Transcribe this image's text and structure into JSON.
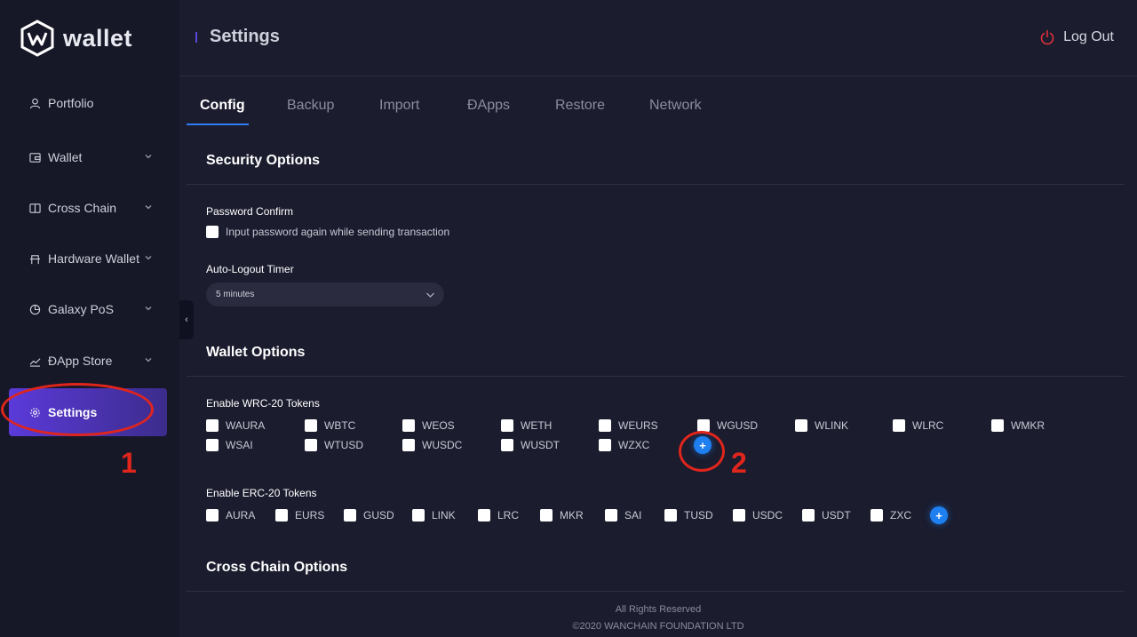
{
  "app": {
    "logo_text": "wallet"
  },
  "sidebar": {
    "items": [
      {
        "label": "Portfolio",
        "icon": "user-icon",
        "has_chevron": false
      },
      {
        "label": "Wallet",
        "icon": "wallet-icon",
        "has_chevron": true
      },
      {
        "label": "Cross Chain",
        "icon": "cross-chain-icon",
        "has_chevron": true
      },
      {
        "label": "Hardware Wallet",
        "icon": "hardware-icon",
        "has_chevron": true
      },
      {
        "label": "Galaxy PoS",
        "icon": "pie-chart-icon",
        "has_chevron": true
      },
      {
        "label": "ĐApp Store",
        "icon": "line-chart-icon",
        "has_chevron": true
      },
      {
        "label": "Settings",
        "icon": "gear-icon",
        "has_chevron": false,
        "active": true
      }
    ]
  },
  "header": {
    "title": "Settings",
    "logout_label": "Log Out"
  },
  "tabs": [
    {
      "label": "Config",
      "active": true
    },
    {
      "label": "Backup"
    },
    {
      "label": "Import"
    },
    {
      "label": "ĐApps"
    },
    {
      "label": "Restore"
    },
    {
      "label": "Network"
    }
  ],
  "security": {
    "title": "Security Options",
    "password_confirm_label": "Password Confirm",
    "password_confirm_checkbox": "Input password again while sending transaction",
    "password_confirm_checked": false,
    "auto_logout_label": "Auto-Logout Timer",
    "auto_logout_value": "5 minutes"
  },
  "wallet_options": {
    "title": "Wallet Options",
    "wrc20_label": "Enable WRC-20 Tokens",
    "wrc20_tokens": [
      "WAURA",
      "WBTC",
      "WEOS",
      "WETH",
      "WEURS",
      "WGUSD",
      "WLINK",
      "WLRC",
      "WMKR",
      "WSAI",
      "WTUSD",
      "WUSDC",
      "WUSDT",
      "WZXC"
    ],
    "erc20_label": "Enable ERC-20 Tokens",
    "erc20_tokens": [
      "AURA",
      "EURS",
      "GUSD",
      "LINK",
      "LRC",
      "MKR",
      "SAI",
      "TUSD",
      "USDC",
      "USDT",
      "ZXC"
    ],
    "add_label": "+"
  },
  "cross_chain": {
    "title": "Cross Chain Options"
  },
  "footer": {
    "line1": "All Rights Reserved",
    "line2": "©2020 WANCHAIN FOUNDATION LTD"
  },
  "annotations": {
    "one": "1",
    "two": "2"
  },
  "colors": {
    "accent": "#5b3ad9",
    "tab_underline": "#2e7cf6",
    "plus_button": "#1e7ff0",
    "annotation": "#e0251c",
    "logout_icon": "#e0313c"
  }
}
